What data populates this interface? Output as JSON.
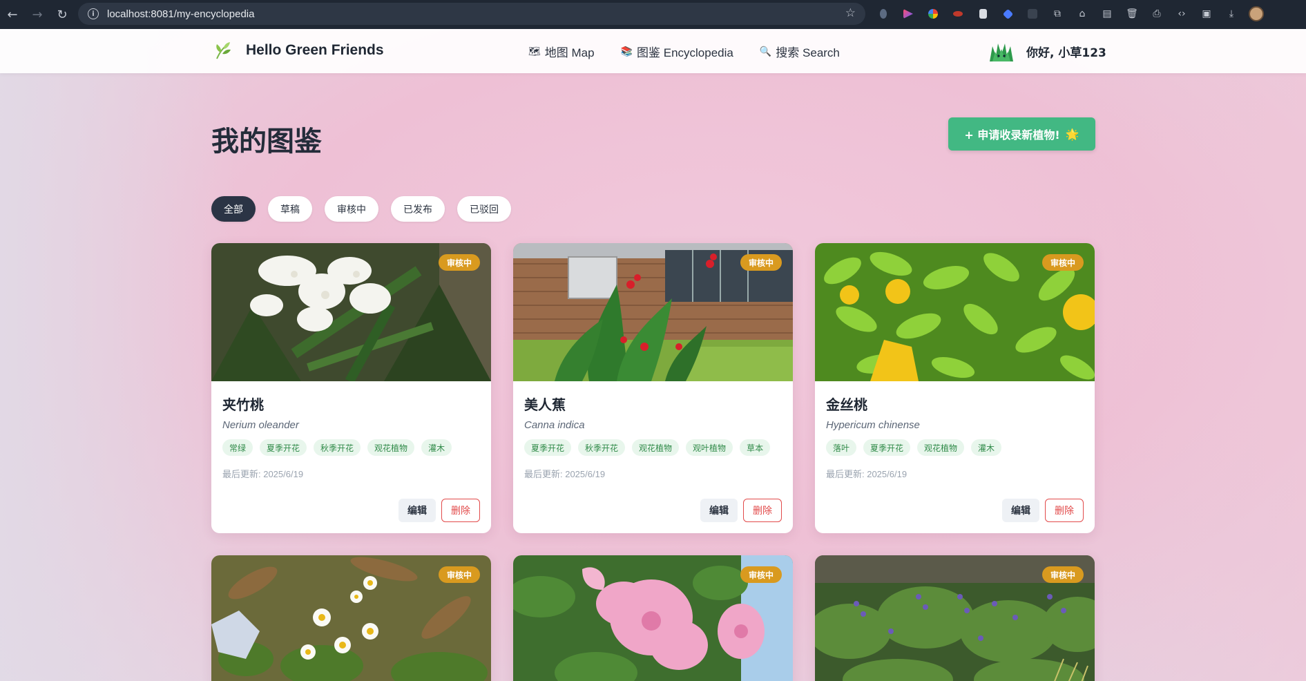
{
  "browser": {
    "url": "localhost:8081/my-encyclopedia"
  },
  "header": {
    "brand": "Hello Green Friends",
    "menu": [
      {
        "icon": "🗺",
        "label": "地图 Map"
      },
      {
        "icon": "📚",
        "label": "图鉴 Encyclopedia"
      },
      {
        "icon": "🔍",
        "label": "搜索 Search"
      }
    ],
    "greeting": "你好, 小草123"
  },
  "page": {
    "title": "我的图鉴",
    "apply_button": "+ 申请收录新植物!",
    "apply_icon": "🌟"
  },
  "filters": [
    {
      "label": "全部",
      "active": true
    },
    {
      "label": "草稿",
      "active": false
    },
    {
      "label": "审核中",
      "active": false
    },
    {
      "label": "已发布",
      "active": false
    },
    {
      "label": "已驳回",
      "active": false
    }
  ],
  "cards": [
    {
      "status": "审核中",
      "name": "夹竹桃",
      "latin": "Nerium oleander",
      "tags": [
        "常绿",
        "夏季开花",
        "秋季开花",
        "观花植物",
        "灌木"
      ],
      "updated": "最后更新: 2025/6/19",
      "edit": "编辑",
      "delete": "删除"
    },
    {
      "status": "审核中",
      "name": "美人蕉",
      "latin": "Canna indica",
      "tags": [
        "夏季开花",
        "秋季开花",
        "观花植物",
        "观叶植物",
        "草本"
      ],
      "updated": "最后更新: 2025/6/19",
      "edit": "编辑",
      "delete": "删除"
    },
    {
      "status": "审核中",
      "name": "金丝桃",
      "latin": "Hypericum chinense",
      "tags": [
        "落叶",
        "夏季开花",
        "观花植物",
        "灌木"
      ],
      "updated": "最后更新: 2025/6/19",
      "edit": "编辑",
      "delete": "删除"
    },
    {
      "status": "审核中"
    },
    {
      "status": "审核中"
    },
    {
      "status": "审核中"
    }
  ],
  "colors": {
    "accent": "#42b883",
    "badge": "#d99a1f",
    "delete": "#e24a4a",
    "tag_bg": "#e8f6ec",
    "tag_text": "#2f8a48"
  }
}
